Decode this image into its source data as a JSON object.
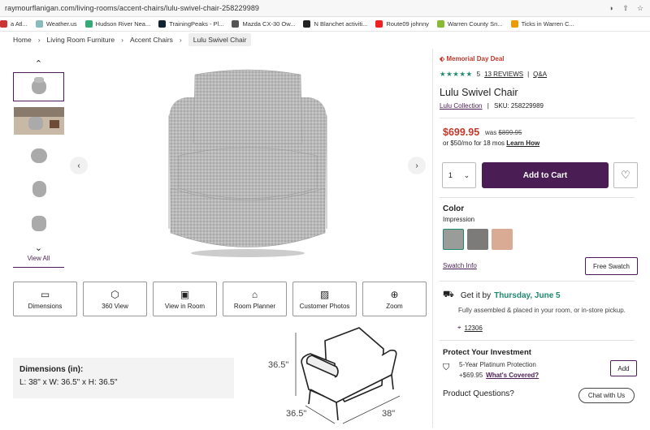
{
  "browser": {
    "url": "raymourflanigan.com/living-rooms/accent-chairs/lulu-swivel-chair-258229989",
    "bookmarks": [
      {
        "label": "a Atl...",
        "color": "#c33"
      },
      {
        "label": "Weather.us",
        "color": "#8bb"
      },
      {
        "label": "Hudson River Nea...",
        "color": "#3a7"
      },
      {
        "label": "TrainingPeaks - Pl...",
        "color": "#123"
      },
      {
        "label": "Mazda CX-30 Ow...",
        "color": "#555"
      },
      {
        "label": "N Blanchet activiti...",
        "color": "#222"
      },
      {
        "label": "Route09 johnny",
        "color": "#e22"
      },
      {
        "label": "Warren County Sn...",
        "color": "#8b3"
      },
      {
        "label": "Ticks in Warren C...",
        "color": "#e90"
      }
    ]
  },
  "breadcrumb": [
    "Home",
    "Living Room Furniture",
    "Accent Chairs",
    "Lulu Swivel Chair"
  ],
  "gallery": {
    "view_all": "View All",
    "features": [
      {
        "label": "Dimensions",
        "icon": "ruler-icon",
        "glyph": "▭"
      },
      {
        "label": "360 View",
        "icon": "cube-icon",
        "glyph": "⬡"
      },
      {
        "label": "View in Room",
        "icon": "room-icon",
        "glyph": "▣"
      },
      {
        "label": "Room Planner",
        "icon": "planner-icon",
        "glyph": "⌂"
      },
      {
        "label": "Customer Photos",
        "icon": "photo-icon",
        "glyph": "▨"
      },
      {
        "label": "Zoom",
        "icon": "zoom-icon",
        "glyph": "⊕"
      }
    ]
  },
  "dimensions": {
    "title": "Dimensions (in):",
    "text": "L: 38\" x W: 36.5\" x H: 36.5\"",
    "height_label": "36.5\"",
    "width_label": "36.5\"",
    "length_label": "38\""
  },
  "product": {
    "promo": "Memorial Day Deal",
    "stars": "★★★★★",
    "rating": "5",
    "reviews": "13 REVIEWS",
    "qa": "Q&A",
    "title": "Lulu Swivel Chair",
    "collection": "Lulu Collection",
    "sku": "SKU: 258229989",
    "price": "$699.95",
    "was_label": "was",
    "was_price": "$899.95",
    "financing": "or $50/mo for 18 mos",
    "learn_how": "Learn How",
    "qty": "1",
    "add_to_cart": "Add to Cart",
    "color_label": "Color",
    "color_value": "Impression",
    "swatches": [
      "#9a9c9a",
      "#7d7b7a",
      "#d9aa94"
    ],
    "swatch_info": "Swatch Info",
    "free_swatch": "Free Swatch",
    "get_it": "Get it by",
    "delivery_date": "Thursday, June 5",
    "assembled": "Fully assembled & placed in your room, or in-store pickup.",
    "zip": "12306",
    "protect_title": "Protect Your Investment",
    "protect_plan": "5-Year Platinum Protection",
    "protect_price": "+$69.95",
    "whats_covered": "What's Covered?",
    "add": "Add",
    "questions": "Product Questions?",
    "chat": "Chat with Us"
  }
}
